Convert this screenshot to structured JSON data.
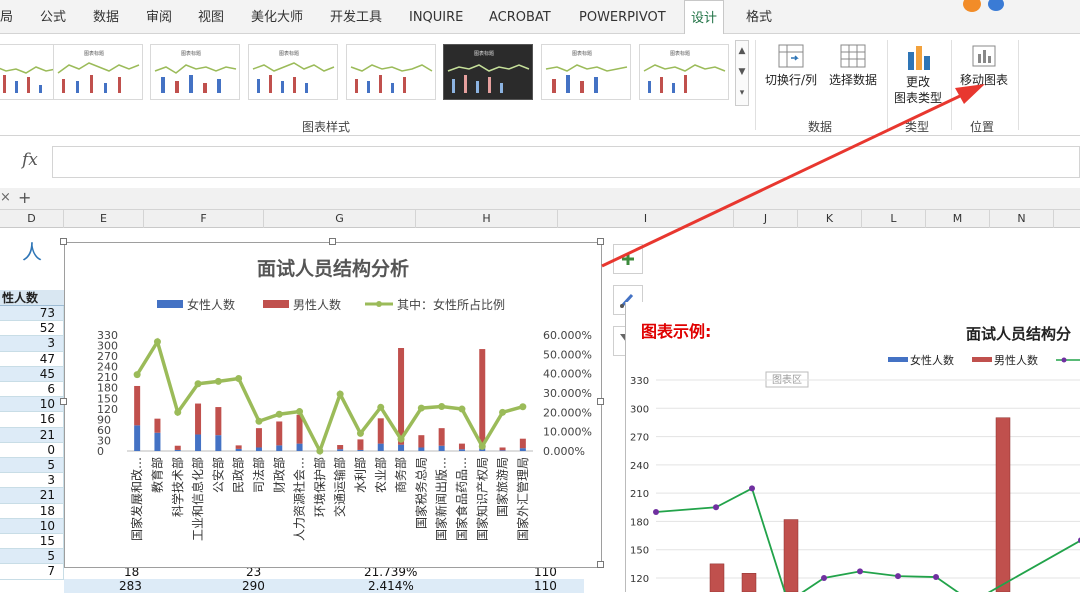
{
  "ribbon_tabs": [
    "局",
    "公式",
    "数据",
    "审阅",
    "视图",
    "美化大师",
    "开发工具",
    "INQUIRE",
    "ACROBAT",
    "POWERPIVOT",
    "设计",
    "格式"
  ],
  "active_tab": "设计",
  "groups": {
    "styles_label": "图表样式",
    "data_label": "数据",
    "type_label": "类型",
    "location_label": "位置"
  },
  "buttons": {
    "switch_row_col": "切换行/列",
    "select_data": "选择数据",
    "change_type_1": "更改",
    "change_type_2": "图表类型",
    "move_chart": "移动图表"
  },
  "formula_bar": {
    "fx": "fx",
    "value": ""
  },
  "sheet_tab_close": "×",
  "sheet_tab_add": "+",
  "columns": [
    "D",
    "E",
    "F",
    "G",
    "H",
    "I",
    "J",
    "K",
    "L",
    "M",
    "N"
  ],
  "cells": {
    "header_text": "人",
    "col_d_header": "性人数",
    "col_d_values": [
      "73",
      "52",
      "3",
      "47",
      "45",
      "6",
      "10",
      "16",
      "21",
      "0",
      "5",
      "3",
      "21",
      "18",
      "10",
      "15",
      "5",
      "7"
    ],
    "bottom_rows": [
      {
        "e": "18",
        "f": "23",
        "g": "21.739%",
        "h": "110"
      },
      {
        "e": "283",
        "f": "290",
        "g": "2.414%",
        "h": "110"
      }
    ]
  },
  "chart1": {
    "title": "面试人员结构分析",
    "legend": [
      "女性人数",
      "男性人数",
      "其中：女性所占比例"
    ]
  },
  "chart2": {
    "example_label": "图表示例:",
    "title": "面试人员结构分",
    "legend": [
      "女性人数",
      "男性人数"
    ],
    "chart_area_tag": "图表区"
  },
  "colors": {
    "female": "#4472c4",
    "male": "#c0504d",
    "ratio": "#9bbb59",
    "accent": "#217346",
    "arrow": "#e8372f"
  },
  "chart_data": [
    {
      "type": "bar",
      "title": "面试人员结构分析",
      "categories": [
        "国家发展和改…",
        "教育部",
        "科学技术部",
        "工业和信息化部",
        "公安部",
        "民政部",
        "司法部",
        "财政部",
        "人力资源社会…",
        "环境保护部",
        "交通运输部",
        "水利部",
        "农业部",
        "商务部",
        "国家税务总局",
        "国家新闻出版…",
        "国家食品药品…",
        "国家知识产权局",
        "国家旅游局",
        "国家外汇管理局"
      ],
      "series": [
        {
          "name": "女性人数",
          "values": [
            73,
            52,
            3,
            47,
            45,
            6,
            10,
            16,
            21,
            0,
            5,
            3,
            21,
            18,
            10,
            15,
            5,
            7,
            2,
            8
          ]
        },
        {
          "name": "男性人数",
          "values": [
            112,
            40,
            12,
            88,
            80,
            10,
            55,
            68,
            82,
            3,
            12,
            30,
            72,
            275,
            35,
            50,
            16,
            283,
            8,
            27
          ]
        },
        {
          "name": "其中：女性所占比例",
          "values": [
            0.395,
            0.565,
            0.2,
            0.348,
            0.36,
            0.375,
            0.154,
            0.19,
            0.204,
            0,
            0.294,
            0.091,
            0.226,
            0.061,
            0.222,
            0.23,
            0.217,
            0.024,
            0.2,
            0.229
          ]
        }
      ],
      "y_left": {
        "min": 0,
        "max": 330,
        "ticks": [
          330,
          300,
          270,
          240,
          210,
          180,
          150,
          120,
          90,
          60,
          30,
          0
        ]
      },
      "y_right": {
        "min": 0,
        "max": 0.6,
        "ticks": [
          "60.000%",
          "50.000%",
          "40.000%",
          "30.000%",
          "20.000%",
          "10.000%",
          "0.000%"
        ]
      },
      "legend_position": "top"
    },
    {
      "type": "bar",
      "title": "面试人员结构分",
      "y_ticks": [
        330,
        300,
        270,
        240,
        210,
        180,
        150,
        120
      ],
      "male_values": [
        135,
        125,
        182,
        290
      ],
      "ratio_line": [
        190,
        195,
        215,
        0,
        120,
        127,
        122,
        121,
        0,
        160
      ]
    }
  ]
}
